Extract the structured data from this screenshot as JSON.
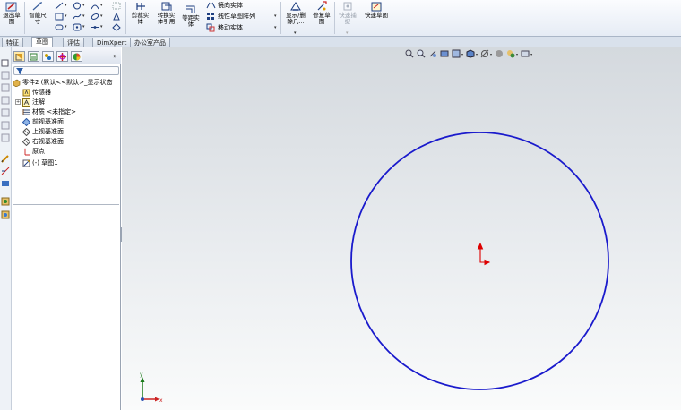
{
  "ribbon": {
    "exit_sketch": "退出草图",
    "smart_dimension": "智能尺寸",
    "trim": "剪裁实体",
    "convert": "转换实体引用",
    "offset": "等距实体",
    "mirror": "镜向实体",
    "linear_pattern": "线性草图阵列",
    "move": "移动实体",
    "display_relations": "显示/删除几...",
    "repair_sketch": "修复草图",
    "quick_snaps": "快速捕捉",
    "rapid_sketch": "快速草图"
  },
  "tabs": [
    {
      "label": "特征",
      "active": false
    },
    {
      "label": "草图",
      "active": true
    },
    {
      "label": "评估",
      "active": false
    },
    {
      "label": "DimXpert",
      "active": false
    },
    {
      "label": "办公室产品",
      "active": false
    }
  ],
  "feature_manager": {
    "expand_glyph": "»",
    "root": "零件2 (默认<<默认>_显示状态",
    "items": [
      {
        "label": "传感器",
        "icon": "sensor-icon",
        "expandable": false
      },
      {
        "label": "注解",
        "icon": "annotation-icon",
        "expandable": true
      },
      {
        "label": "材质 <未指定>",
        "icon": "material-icon",
        "expandable": false
      },
      {
        "label": "前视基准面",
        "icon": "plane-icon",
        "expandable": false
      },
      {
        "label": "上视基准面",
        "icon": "plane-icon",
        "expandable": false
      },
      {
        "label": "右视基准面",
        "icon": "plane-icon",
        "expandable": false
      },
      {
        "label": "原点",
        "icon": "origin-icon",
        "expandable": false
      }
    ],
    "sketch": "(-) 草图1"
  },
  "colors": {
    "circle": "#1a1acc",
    "origin": "#dd0000",
    "accent": "#2b63b8"
  },
  "triad_labels": {
    "x": "x",
    "y": "y"
  }
}
